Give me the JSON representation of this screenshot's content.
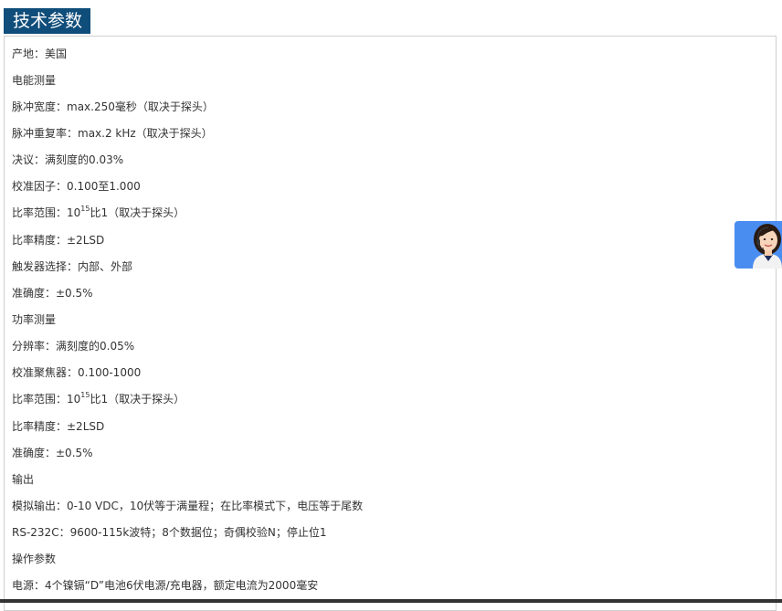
{
  "header": {
    "title": "技术参数"
  },
  "specs": [
    {
      "text": "产地：美国"
    },
    {
      "text": "电能测量"
    },
    {
      "text": "脉冲宽度：max.250毫秒（取决于探头）"
    },
    {
      "text": "脉冲重复率：max.2 kHz（取决于探头）"
    },
    {
      "text": "决议：满刻度的0.03%"
    },
    {
      "text": "校准因子：0.100至1.000"
    },
    {
      "pre": "比率范围：10",
      "sup": "15",
      "post": "比1（取决于探头）"
    },
    {
      "text": "比率精度：±2LSD"
    },
    {
      "text": "触发器选择：内部、外部"
    },
    {
      "text": "准确度：±0.5%"
    },
    {
      "text": "功率测量"
    },
    {
      "text": "分辨率：满刻度的0.05%"
    },
    {
      "text": "校准聚焦器：0.100-1000"
    },
    {
      "pre": "比率范围：10",
      "sup": "15",
      "post": "比1（取决于探头）"
    },
    {
      "text": "比率精度：±2LSD"
    },
    {
      "text": "准确度：±0.5%"
    },
    {
      "text": "输出"
    },
    {
      "text": "模拟输出：0-10 VDC，10伏等于满量程；在比率模式下，电压等于尾数"
    },
    {
      "text": "RS-232C：9600-115k波特；8个数据位；奇偶校验N；停止位1"
    },
    {
      "text": "操作参数"
    },
    {
      "text": "电源：4个镍镉“D”电池6伏电源/充电器，额定电流为2000毫安"
    }
  ],
  "widget": {
    "icon": "customer-service-icon",
    "color": "#4a8df0"
  },
  "colors": {
    "header_bg": "#0f4d7a",
    "text": "#333333",
    "border": "#cfcfcf"
  }
}
